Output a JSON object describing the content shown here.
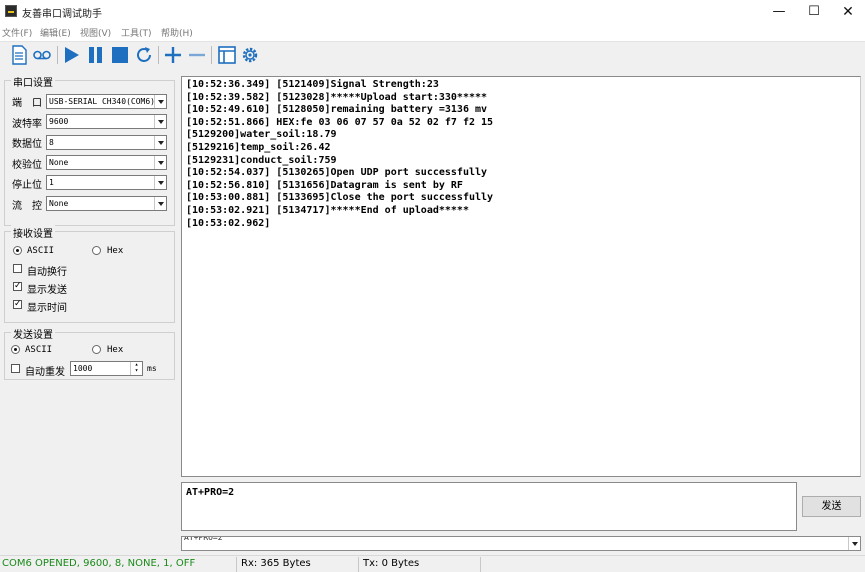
{
  "window": {
    "title": "友善串口调试助手",
    "controls": {
      "minimize": "—",
      "maximize": "☐",
      "close": "✕"
    }
  },
  "menu": [
    "文件(F)",
    "编辑(E)",
    "视图(V)",
    "工具(T)",
    "帮助(H)"
  ],
  "toolbar": {
    "icons": [
      "new-document-icon",
      "record-icon",
      "play-icon",
      "pause-icon",
      "stop-icon",
      "refresh-icon",
      "add-icon",
      "remove-icon",
      "window-layout-icon",
      "settings-gear-icon"
    ],
    "accent": "#1e6fbf"
  },
  "serial": {
    "title": "串口设置",
    "port_label": "端　口",
    "port": "USB-SERIAL CH340(COM6)",
    "baud_label": "波特率",
    "baud": "9600",
    "data_label": "数据位",
    "data": "8",
    "parity_label": "校验位",
    "parity": "None",
    "stop_label": "停止位",
    "stop": "1",
    "flow_label": "流　控",
    "flow": "None"
  },
  "receive": {
    "title": "接收设置",
    "ascii": "ASCII",
    "hex": "Hex",
    "mode": "ASCII",
    "auto_wrap": "自动换行",
    "auto_wrap_checked": false,
    "show_send": "显示发送",
    "show_send_checked": true,
    "show_time": "显示时间",
    "show_time_checked": true
  },
  "send": {
    "title": "发送设置",
    "ascii": "ASCII",
    "hex": "Hex",
    "mode": "ASCII",
    "auto_resend": "自动重发",
    "auto_resend_checked": false,
    "interval": "1000",
    "unit": "ms",
    "input": "AT+PRO=2",
    "button": "发送",
    "history": "AT+PRO=2"
  },
  "log": [
    "[10:52:36.349] [5121409]Signal Strength:23",
    "[10:52:39.582] [5123028]*****Upload start:330*****",
    "[10:52:49.610] [5128050]remaining battery =3136 mv",
    "[10:52:51.866] HEX:fe 03 06 07 57 0a 52 02 f7 f2 15",
    "[5129200]water_soil:18.79",
    "[5129216]temp_soil:26.42",
    "[5129231]conduct_soil:759",
    "[10:52:54.037] [5130265]Open UDP port successfully",
    "[10:52:56.810] [5131656]Datagram is sent by RF",
    "[10:53:00.881] [5133695]Close the port successfully",
    "[10:53:02.921] [5134717]*****End of upload*****",
    "[10:53:02.962]"
  ],
  "status": {
    "connection": "COM6 OPENED, 9600, 8, NONE, 1, OFF",
    "connection_color": "#1a8a1a",
    "rx": "Rx: 365 Bytes",
    "tx": "Tx: 0 Bytes"
  }
}
